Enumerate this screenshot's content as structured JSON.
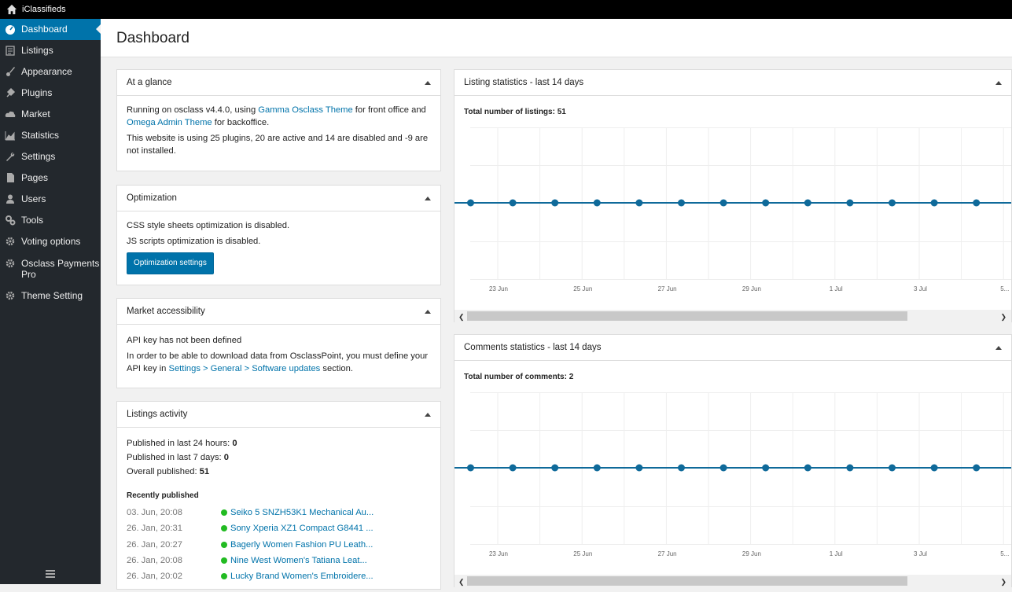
{
  "site_name": "iClassifieds",
  "sidebar": {
    "items": [
      {
        "label": "Dashboard",
        "icon": "dashboard-icon"
      },
      {
        "label": "Listings",
        "icon": "listings-icon"
      },
      {
        "label": "Appearance",
        "icon": "brush-icon"
      },
      {
        "label": "Plugins",
        "icon": "plug-icon"
      },
      {
        "label": "Market",
        "icon": "cloud-icon"
      },
      {
        "label": "Statistics",
        "icon": "area-chart-icon"
      },
      {
        "label": "Settings",
        "icon": "wrench-icon"
      },
      {
        "label": "Pages",
        "icon": "page-icon"
      },
      {
        "label": "Users",
        "icon": "user-icon"
      },
      {
        "label": "Tools",
        "icon": "gears-icon"
      },
      {
        "label": "Voting options",
        "icon": "gear-icon"
      },
      {
        "label": "Osclass Payments Pro",
        "icon": "gear-icon"
      },
      {
        "label": "Theme Setting",
        "icon": "gear-icon"
      }
    ]
  },
  "page_title": "Dashboard",
  "glance": {
    "title": "At a glance",
    "t1": "Running on osclass v4.4.0, using ",
    "link1": "Gamma Osclass Theme",
    "t2": " for front office and ",
    "link2": "Omega Admin Theme",
    "t3": " for backoffice.",
    "plugins": "This website is using 25 plugins, 20 are active and 14 are disabled and -9 are not installed."
  },
  "optimization": {
    "title": "Optimization",
    "css": "CSS style sheets optimization is disabled.",
    "js": "JS scripts optimization is disabled.",
    "button": "Optimization settings"
  },
  "market": {
    "title": "Market accessibility",
    "line1": "API key has not been defined",
    "t1": "In order to be able to download data from OsclassPoint, you must define your API key in ",
    "link": "Settings > General > Software updates",
    "t2": " section."
  },
  "activity": {
    "title": "Listings activity",
    "last24_label": "Published in last 24 hours: ",
    "last24_value": "0",
    "last7_label": "Published in last 7 days: ",
    "last7_value": "0",
    "overall_label": "Overall published: ",
    "overall_value": "51",
    "recent_heading": "Recently published",
    "recent": [
      {
        "date": "03. Jun, 20:08",
        "title": "Seiko 5 SNZH53K1 Mechanical Au..."
      },
      {
        "date": "26. Jan, 20:31",
        "title": "Sony Xperia XZ1 Compact G8441 ..."
      },
      {
        "date": "26. Jan, 20:27",
        "title": "Bagerly Women Fashion PU Leath..."
      },
      {
        "date": "26. Jan, 20:08",
        "title": "Nine West Women's Tatiana Leat..."
      },
      {
        "date": "26. Jan, 20:02",
        "title": "Lucky Brand Women's Embroidere..."
      }
    ]
  },
  "listing_stats": {
    "title": "Listing statistics - last 14 days",
    "total": "Total number of listings: 51"
  },
  "comment_stats": {
    "title": "Comments statistics - last 14 days",
    "total": "Total number of comments: 2"
  },
  "colors": {
    "accent": "#0073aa",
    "sidebar": "#23282d",
    "active_dot": "#22bb22"
  },
  "chart_data": [
    {
      "type": "line",
      "title": "Listing statistics - last 14 days",
      "x_tick_labels": [
        "23 Jun",
        "25 Jun",
        "27 Jun",
        "29 Jun",
        "1 Jul",
        "3 Jul",
        "5..."
      ],
      "series": [
        {
          "values": [
            0,
            0,
            0,
            0,
            0,
            0,
            0,
            0,
            0,
            0,
            0,
            0,
            0
          ]
        }
      ],
      "grid": true
    },
    {
      "type": "line",
      "title": "Comments statistics - last 14 days",
      "x_tick_labels": [
        "23 Jun",
        "25 Jun",
        "27 Jun",
        "29 Jun",
        "1 Jul",
        "3 Jul",
        "5..."
      ],
      "series": [
        {
          "values": [
            0,
            0,
            0,
            0,
            0,
            0,
            0,
            0,
            0,
            0,
            0,
            0,
            0
          ]
        }
      ],
      "grid": true
    }
  ]
}
